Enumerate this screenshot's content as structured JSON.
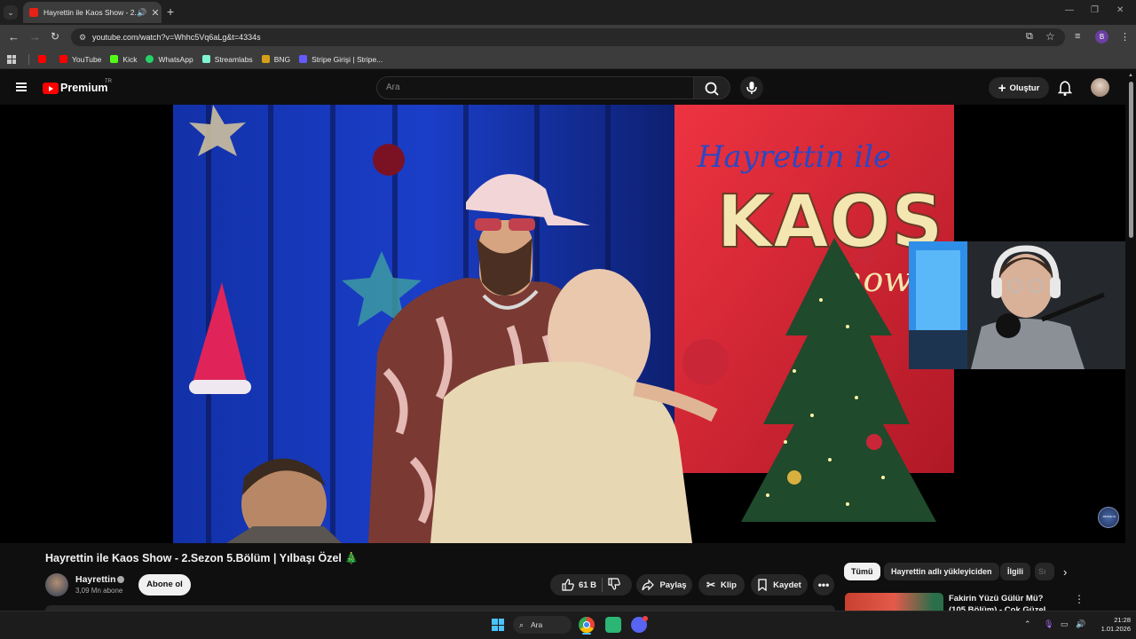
{
  "browser": {
    "tab_title": "Hayrettin ile Kaos Show - 2.",
    "url": "youtube.com/watch?v=Whhc5Vq6aLg&t=4334s",
    "bookmarks": [
      {
        "label": "YouTube",
        "color": "#ff0000"
      },
      {
        "label": "Kick",
        "color": "#53fc18"
      },
      {
        "label": "WhatsApp",
        "color": "#25d366"
      },
      {
        "label": "Streamlabs",
        "color": "#80f5d2"
      },
      {
        "label": "BNG",
        "color": "#d4a017"
      },
      {
        "label": "Stripe Girişi | Stripe...",
        "color": "#635bff"
      }
    ],
    "profile_initial": "B"
  },
  "youtube": {
    "brand": "Premium",
    "country": "TR",
    "search_placeholder": "Ara",
    "create_label": "Oluştur"
  },
  "video": {
    "title": "Hayrettin ile Kaos Show - 2.Sezon 5.Bölüm | Yılbaşı Özel 🎄",
    "channel": "Hayrettin",
    "subscribers": "3,09 Mn abone",
    "subscribe_label": "Abone ol",
    "likes": "61 B",
    "share_label": "Paylaş",
    "clip_label": "Klip",
    "save_label": "Kaydet",
    "overlay_sign_text": "Hayrettin ile KAOS Show",
    "badge_text": "ABONE OL"
  },
  "sidebar": {
    "chips": [
      "Tümü",
      "Hayrettin adlı yükleyiciden",
      "İlgili",
      "Sı"
    ],
    "recommended": [
      {
        "title": "Fakirin Yüzü Gülür Mü? (105.Bölüm) - Çok Güzel"
      }
    ]
  },
  "taskbar": {
    "search_label": "Ara",
    "time": "21:28",
    "date": "1.01.2026"
  },
  "colors": {
    "accent": "#ff0000",
    "page_bg": "#0f0f0f"
  }
}
